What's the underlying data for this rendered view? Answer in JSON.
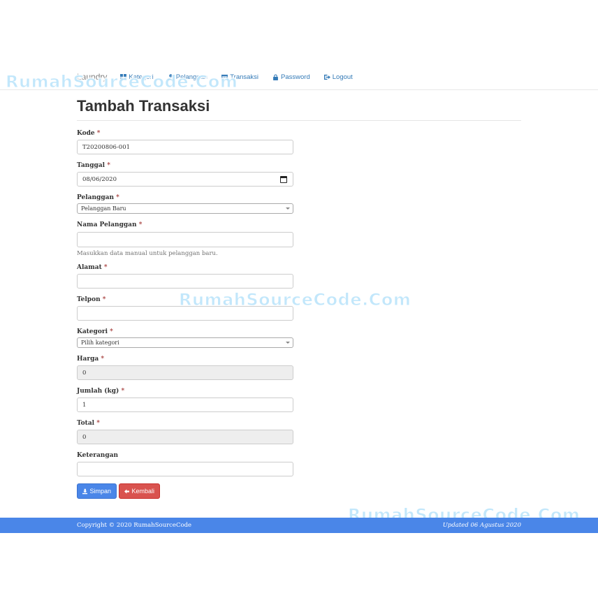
{
  "watermark": "RumahSourceCode.Com",
  "nav": {
    "brand": "Laundry",
    "items": [
      {
        "label": "Kategori",
        "icon": "grid-icon"
      },
      {
        "label": "Pelanggan",
        "icon": "user-icon"
      },
      {
        "label": "Transaksi",
        "icon": "calendar-icon"
      },
      {
        "label": "Password",
        "icon": "lock-icon"
      },
      {
        "label": "Logout",
        "icon": "logout-icon"
      }
    ]
  },
  "page": {
    "title": "Tambah Transaksi"
  },
  "form": {
    "kode": {
      "label": "Kode",
      "value": "T20200806-001"
    },
    "tanggal": {
      "label": "Tanggal",
      "value": "08/06/2020"
    },
    "pelanggan": {
      "label": "Pelanggan",
      "value": "Pelanggan Baru"
    },
    "nama": {
      "label": "Nama Pelanggan",
      "value": "",
      "help": "Masukkan data manual untuk pelanggan baru."
    },
    "alamat": {
      "label": "Alamat",
      "value": ""
    },
    "telpon": {
      "label": "Telpon",
      "value": ""
    },
    "kategori": {
      "label": "Kategori",
      "value": "Pilih kategori"
    },
    "harga": {
      "label": "Harga",
      "value": "0"
    },
    "jumlah": {
      "label": "Jumlah (kg)",
      "value": "1"
    },
    "total": {
      "label": "Total",
      "value": "0"
    },
    "keterangan": {
      "label": "Keterangan",
      "value": ""
    },
    "required_mark": "*"
  },
  "buttons": {
    "save": "Simpan",
    "back": "Kembali"
  },
  "footer": {
    "copyright": "Copyright © 2020 RumahSourceCode",
    "updated": "Updated 06 Agustus 2020"
  },
  "colors": {
    "primary": "#4a86e8",
    "danger": "#d9534f",
    "link": "#337ab7",
    "watermark": "#bfe6fb"
  }
}
